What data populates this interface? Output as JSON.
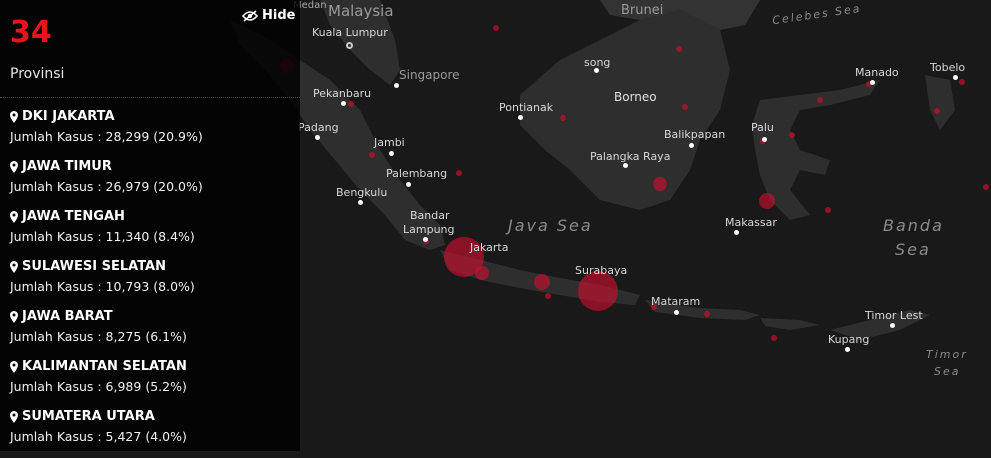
{
  "summary": {
    "count": "34",
    "label": "Provinsi"
  },
  "hide_button": {
    "label": "Hide",
    "icon": "eye-slash-icon"
  },
  "provinces": [
    {
      "name": "DKI JAKARTA",
      "cases": "Jumlah Kasus : 28,299 (20.9%)"
    },
    {
      "name": "JAWA TIMUR",
      "cases": "Jumlah Kasus : 26,979 (20.0%)"
    },
    {
      "name": "JAWA TENGAH",
      "cases": "Jumlah Kasus : 11,340 (8.4%)"
    },
    {
      "name": "SULAWESI SELATAN",
      "cases": "Jumlah Kasus : 10,793 (8.0%)"
    },
    {
      "name": "JAWA BARAT",
      "cases": "Jumlah Kasus : 8,275 (6.1%)"
    },
    {
      "name": "KALIMANTAN SELATAN",
      "cases": "Jumlah Kasus : 6,989 (5.2%)"
    },
    {
      "name": "SUMATERA UTARA",
      "cases": "Jumlah Kasus : 5,427 (4.0%)"
    }
  ],
  "map": {
    "countries": {
      "malaysia": "Malaysia",
      "brunei": "Brunei"
    },
    "islands": {
      "borneo": "Borneo"
    },
    "seas": {
      "celebes": "Celebes Sea",
      "java": "Java Sea",
      "banda_1": "Banda",
      "banda_2": "Sea",
      "timor_1": "Timor",
      "timor_2": "Sea"
    },
    "cities": {
      "medan": "Medan",
      "kuala_lumpur": "Kuala Lumpur",
      "singapore": "Singapore",
      "pekanbaru": "Pekanbaru",
      "padang": "Padang",
      "jambi": "Jambi",
      "palembang": "Palembang",
      "bengkulu": "Bengkulu",
      "bandar_1": "Bandar",
      "bandar_2": "Lampung",
      "jakarta": "Jakarta",
      "surabaya": "Surabaya",
      "mataram": "Mataram",
      "pontianak": "Pontianak",
      "song": "song",
      "balikpapan": "Balikpapan",
      "palangka": "Palangka Raya",
      "palu": "Palu",
      "makassar": "Makassar",
      "manado": "Manado",
      "tobelo": "Tobelo",
      "timor_leste": "Timor Lest",
      "kupang": "Kupang"
    },
    "colors": {
      "land": "#2e2e2e",
      "water": "#191919",
      "marker": "#c8102e"
    }
  }
}
